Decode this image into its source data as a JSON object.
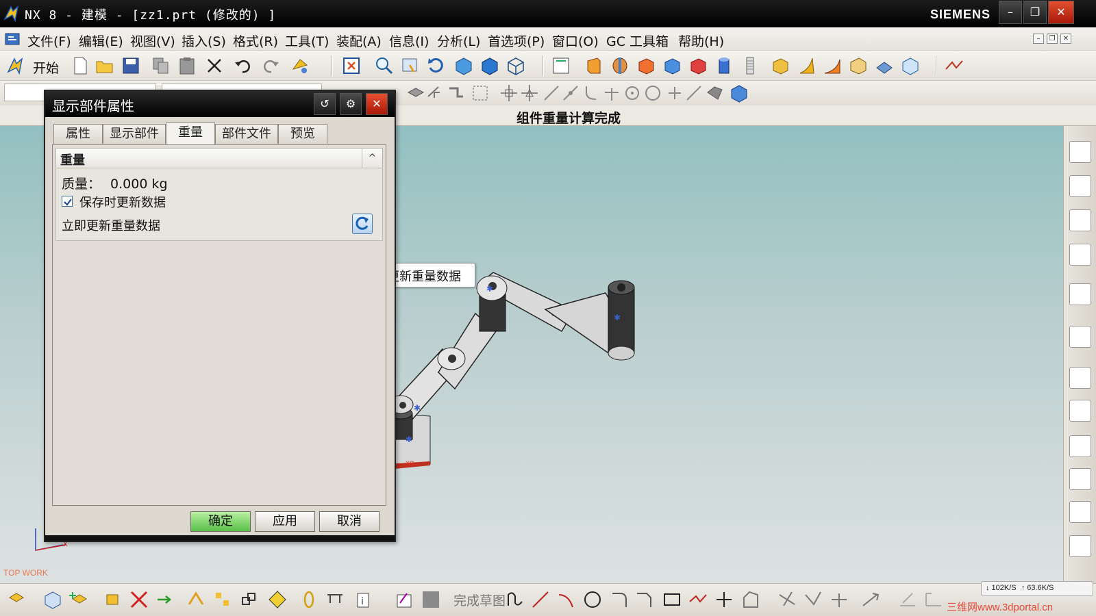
{
  "window": {
    "title": "NX 8 - 建模 - [zz1.prt (修改的) ]",
    "brand": "SIEMENS",
    "minimize": "–",
    "restore": "❐",
    "close": "✕"
  },
  "menu": {
    "items": [
      "文件(F)",
      "编辑(E)",
      "视图(V)",
      "插入(S)",
      "格式(R)",
      "工具(T)",
      "装配(A)",
      "信息(I)",
      "分析(L)",
      "首选项(P)",
      "窗口(O)",
      "GC 工具箱",
      "帮助(H)"
    ]
  },
  "toolbar": {
    "start_label": "开始"
  },
  "status": {
    "message": "组件重量计算完成"
  },
  "dialog": {
    "title": "显示部件属性",
    "reset_icon": "↺",
    "settings_icon": "⚙",
    "close_icon": "✕",
    "tabs": [
      "属性",
      "显示部件",
      "重量",
      "部件文件",
      "预览"
    ],
    "active_tab": "重量",
    "group": {
      "title": "重量",
      "collapse_icon": "^",
      "mass_label": "质量：",
      "mass_value": "0.000 kg",
      "save_update_checked": true,
      "save_update_label": "保存时更新数据",
      "update_now_label": "立即更新重量数据"
    },
    "buttons": {
      "ok": "确定",
      "apply": "应用",
      "cancel": "取消"
    }
  },
  "tooltip": {
    "text": "立即更新重量数据"
  },
  "viewport": {
    "view_label": "TOP WORK",
    "axis_xc": "XC",
    "axis_x": "X"
  },
  "bottom_toolbar": {
    "finish_sketch": "完成草图"
  },
  "tray": {
    "download": "↓ 102K/S",
    "upload": "↑ 63.6K/S"
  },
  "watermark": "三维网www.3dportal.cn",
  "colors": {
    "viewport_top": "#93c0c1",
    "viewport_bottom": "#dde2e2",
    "ok_button": "#58c048",
    "close_button": "#c02810",
    "link_gray": "#d8d8d8",
    "pin_dark": "#3a3a3a"
  }
}
